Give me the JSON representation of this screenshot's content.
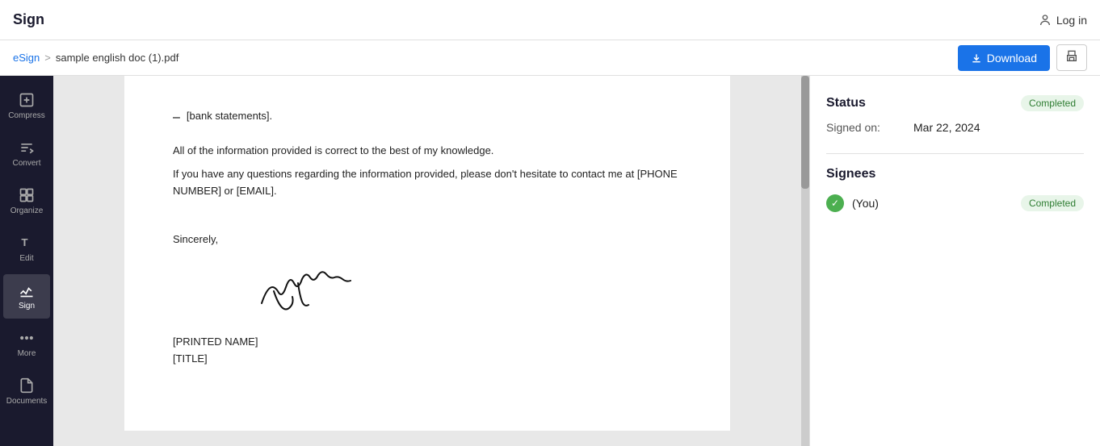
{
  "header": {
    "title": "Sign",
    "login_label": "Log in"
  },
  "breadcrumb": {
    "parent": "eSign",
    "separator": ">",
    "current_file": "sample english doc (1).pdf"
  },
  "toolbar": {
    "download_label": "Download",
    "print_label": "🖨"
  },
  "sidebar": {
    "items": [
      {
        "id": "compress",
        "label": "Compress",
        "icon": "⬛"
      },
      {
        "id": "convert",
        "label": "Convert",
        "icon": "⇄"
      },
      {
        "id": "organize",
        "label": "Organize",
        "icon": "⊞"
      },
      {
        "id": "edit",
        "label": "Edit",
        "icon": "T"
      },
      {
        "id": "sign",
        "label": "Sign",
        "icon": "✍",
        "active": true
      },
      {
        "id": "more",
        "label": "More",
        "icon": "⊞"
      },
      {
        "id": "documents",
        "label": "Documents",
        "icon": "📄"
      }
    ]
  },
  "pdf": {
    "bullet_text": "[bank statements].",
    "paragraph1": "All of the information provided is correct to the best of my knowledge.",
    "paragraph2": "If you have any questions regarding the information provided, please don't hesitate to contact me at [PHONE NUMBER] or [EMAIL].",
    "sincerely": "Sincerely,",
    "printed_name": "[PRINTED NAME]",
    "title_placeholder": "[TITLE]"
  },
  "right_panel": {
    "status_section": {
      "title": "Status",
      "badge": "Completed",
      "signed_on_label": "Signed on:",
      "signed_on_value": "Mar 22, 2024"
    },
    "signees_section": {
      "title": "Signees",
      "signees": [
        {
          "name": "(You)",
          "status": "Completed"
        }
      ]
    }
  },
  "colors": {
    "sidebar_bg": "#1a1a2e",
    "header_bg": "#ffffff",
    "download_btn": "#1a73e8",
    "completed_badge_bg": "#e8f5e9",
    "completed_badge_text": "#2e7d32",
    "check_bg": "#4caf50"
  }
}
